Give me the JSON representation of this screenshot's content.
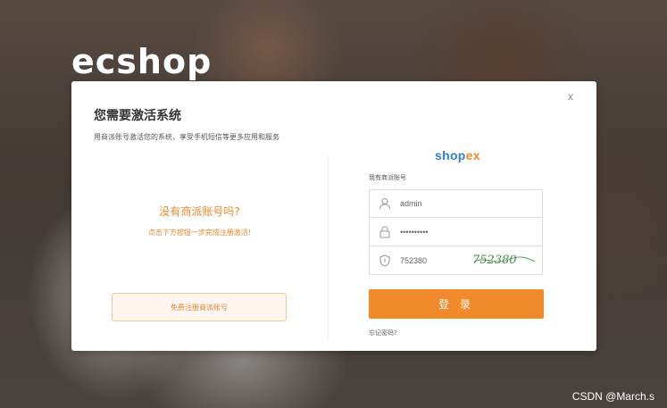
{
  "brand": {
    "logo_text": "ecshop"
  },
  "watermark": "CSDN @March.s",
  "modal": {
    "close_label": "x",
    "title": "您需要激活系统",
    "subtitle": "用商派账号激活您的系统，享受手机短信等更多应用和服务",
    "left": {
      "no_account_title": "没有商派账号吗?",
      "no_account_tip": "点击下方按钮一步完成注册激活!",
      "register_button": "免费注册商派账号"
    },
    "right": {
      "shopex_brand_main": "shop",
      "shopex_brand_accent": "ex",
      "has_account_label": "我有商派账号",
      "username_value": "admin",
      "password_value": "••••••••••",
      "captcha_value": "752380",
      "captcha_image_text": "752380",
      "login_button": "登 录",
      "forgot_password": "忘记密码?"
    }
  },
  "colors": {
    "accent_orange": "#f08a2c",
    "shopex_blue": "#2f7fd5",
    "captcha_green": "#3f8a3f"
  },
  "icons": [
    "user-icon",
    "lock-icon",
    "shield-icon",
    "close-icon"
  ]
}
